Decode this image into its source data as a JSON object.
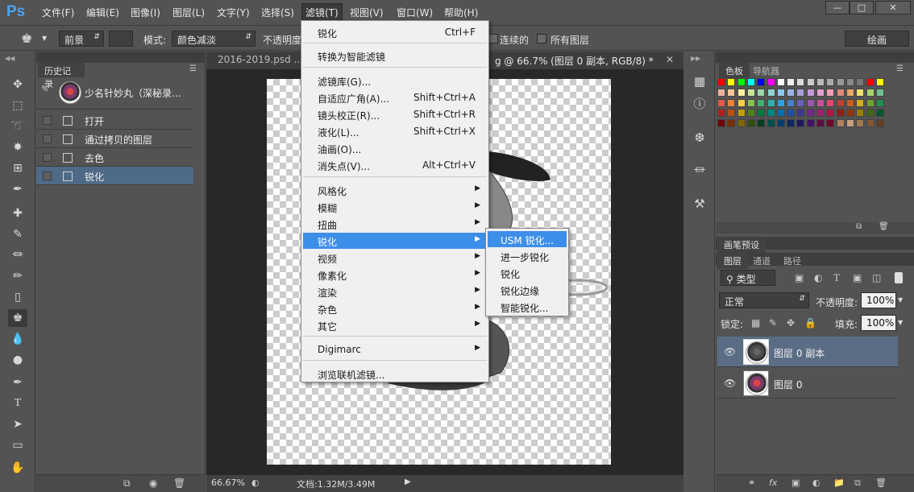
{
  "app": {
    "logo": "Ps"
  },
  "menubar": {
    "items": [
      "文件(F)",
      "编辑(E)",
      "图像(I)",
      "图层(L)",
      "文字(Y)",
      "选择(S)",
      "滤镜(T)",
      "视图(V)",
      "窗口(W)",
      "帮助(H)"
    ],
    "active_index": 6
  },
  "window_controls": {
    "minimize": "—",
    "maximize": "□",
    "close": "✕"
  },
  "options": {
    "fill_source": "前景",
    "mode_label": "模式:",
    "mode_value": "颜色减淡",
    "opacity_label": "不透明度",
    "contiguous_label": "连续的",
    "all_layers_label": "所有图层",
    "workspace": "绘画"
  },
  "history": {
    "tab": "历史记录",
    "snapshot": "少名针妙丸（深秘录…",
    "items": [
      "打开",
      "通过拷贝的图层",
      "去色",
      "锐化"
    ],
    "selected_index": 3
  },
  "document": {
    "tabs": [
      "2016-2019.psd ...",
      "g @ 66.7% (图层 0 副本, RGB/8) *",
      "✕"
    ],
    "zoom": "66.67%",
    "doc_info": "文档:1.32M/3.49M"
  },
  "filter_menu": {
    "items": [
      {
        "label": "锐化",
        "shortcut": "Ctrl+F"
      },
      {
        "label": "转换为智能滤镜",
        "shortcut": ""
      },
      {
        "label": "滤镜库(G)...",
        "shortcut": ""
      },
      {
        "label": "自适应广角(A)...",
        "shortcut": "Shift+Ctrl+A"
      },
      {
        "label": "镜头校正(R)...",
        "shortcut": "Shift+Ctrl+R"
      },
      {
        "label": "液化(L)...",
        "shortcut": "Shift+Ctrl+X"
      },
      {
        "label": "油画(O)...",
        "shortcut": ""
      },
      {
        "label": "消失点(V)...",
        "shortcut": "Alt+Ctrl+V"
      },
      {
        "label": "风格化",
        "shortcut": ""
      },
      {
        "label": "模糊",
        "shortcut": ""
      },
      {
        "label": "扭曲",
        "shortcut": ""
      },
      {
        "label": "锐化",
        "shortcut": ""
      },
      {
        "label": "视频",
        "shortcut": ""
      },
      {
        "label": "像素化",
        "shortcut": ""
      },
      {
        "label": "渲染",
        "shortcut": ""
      },
      {
        "label": "杂色",
        "shortcut": ""
      },
      {
        "label": "其它",
        "shortcut": ""
      },
      {
        "label": "Digimarc",
        "shortcut": ""
      },
      {
        "label": "浏览联机滤镜...",
        "shortcut": ""
      }
    ]
  },
  "sharpen_submenu": {
    "items": [
      "USM 锐化...",
      "进一步锐化",
      "锐化",
      "锐化边缘",
      "智能锐化..."
    ],
    "highlighted_index": 0
  },
  "right_panels": {
    "swatch_tabs": [
      "色板",
      "导航器"
    ],
    "brush_tab": "画笔预设",
    "layer_tabs": [
      "图层",
      "通道",
      "路径"
    ],
    "filter_kind": "类型",
    "blend_mode": "正常",
    "opacity_label": "不透明度:",
    "opacity_value": "100%",
    "lock_label": "锁定:",
    "fill_label": "填充:",
    "fill_value": "100%",
    "layers": [
      "图层 0 副本",
      "图层 0"
    ],
    "selected_layer": 0
  },
  "swatch_colors": [
    "#ff0000",
    "#ffff00",
    "#00ff00",
    "#00ffff",
    "#0000ff",
    "#ff00ff",
    "#ffffff",
    "#eeeeee",
    "#dddddd",
    "#cccccc",
    "#bbbbbb",
    "#aaaaaa",
    "#999999",
    "#888888",
    "#777777",
    "#ff0000",
    "#ffff00",
    "#f0b0a0",
    "#f4c89a",
    "#fff2a0",
    "#c6e59a",
    "#9ad6a6",
    "#8fd3cf",
    "#8fc9ef",
    "#9ab6e0",
    "#a99fd6",
    "#c49ad6",
    "#e0a0cf",
    "#f0a0b6",
    "#e08a7a",
    "#e8a86a",
    "#f0e070",
    "#a8d070",
    "#70c090",
    "#e05a4a",
    "#e8843a",
    "#f0d040",
    "#88c050",
    "#40b070",
    "#30b0a8",
    "#30a0e0",
    "#4880c8",
    "#6860b8",
    "#9858b0",
    "#c85098",
    "#e04870",
    "#c04030",
    "#c86020",
    "#d0b020",
    "#70a030",
    "#209050",
    "#b02020",
    "#b85010",
    "#c0a000",
    "#508020",
    "#007840",
    "#008880",
    "#0070b0",
    "#2050a0",
    "#403890",
    "#702888",
    "#a02070",
    "#b01848",
    "#902010",
    "#903808",
    "#988000",
    "#406818",
    "#005830",
    "#700808",
    "#783000",
    "#806800",
    "#305010",
    "#004020",
    "#005050",
    "#004070",
    "#102860",
    "#201860",
    "#401460",
    "#600c40",
    "#70082c",
    "#b08060",
    "#c8a080",
    "#a07850",
    "#805838",
    "#604028"
  ]
}
